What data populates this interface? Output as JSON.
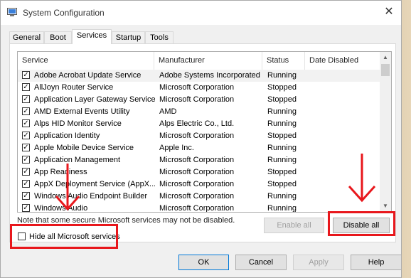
{
  "window": {
    "title": "System Configuration",
    "close_glyph": "✕"
  },
  "tabs": [
    {
      "label": "General"
    },
    {
      "label": "Boot"
    },
    {
      "label": "Services",
      "active": true
    },
    {
      "label": "Startup"
    },
    {
      "label": "Tools"
    }
  ],
  "table": {
    "columns": [
      "Service",
      "Manufacturer",
      "Status",
      "Date Disabled"
    ],
    "rows": [
      {
        "service": "Adobe Acrobat Update Service",
        "manufacturer": "Adobe Systems Incorporated",
        "status": "Running",
        "checked": true
      },
      {
        "service": "AllJoyn Router Service",
        "manufacturer": "Microsoft Corporation",
        "status": "Stopped",
        "checked": true
      },
      {
        "service": "Application Layer Gateway Service",
        "manufacturer": "Microsoft Corporation",
        "status": "Stopped",
        "checked": true
      },
      {
        "service": "AMD External Events Utility",
        "manufacturer": "AMD",
        "status": "Running",
        "checked": true
      },
      {
        "service": "Alps HID Monitor Service",
        "manufacturer": "Alps Electric Co., Ltd.",
        "status": "Running",
        "checked": true
      },
      {
        "service": "Application Identity",
        "manufacturer": "Microsoft Corporation",
        "status": "Stopped",
        "checked": true
      },
      {
        "service": "Apple Mobile Device Service",
        "manufacturer": "Apple Inc.",
        "status": "Running",
        "checked": true
      },
      {
        "service": "Application Management",
        "manufacturer": "Microsoft Corporation",
        "status": "Running",
        "checked": true
      },
      {
        "service": "App Readiness",
        "manufacturer": "Microsoft Corporation",
        "status": "Stopped",
        "checked": true
      },
      {
        "service": "AppX Deployment Service (AppX...",
        "manufacturer": "Microsoft Corporation",
        "status": "Stopped",
        "checked": true
      },
      {
        "service": "Windows Audio Endpoint Builder",
        "manufacturer": "Microsoft Corporation",
        "status": "Running",
        "checked": true
      },
      {
        "service": "Windows Audio",
        "manufacturer": "Microsoft Corporation",
        "status": "Running",
        "checked": true
      }
    ]
  },
  "note": "Note that some secure Microsoft services may not be disabled.",
  "buttons": {
    "enable_all": "Enable all",
    "disable_all": "Disable all",
    "ok": "OK",
    "cancel": "Cancel",
    "apply": "Apply",
    "help": "Help"
  },
  "hide_ms": {
    "label": "Hide all Microsoft services",
    "checked": false
  },
  "check_glyph": "✓",
  "scroll": {
    "up": "▲",
    "down": "▼"
  },
  "colors": {
    "highlight": "#e8171c",
    "accent": "#0078d7"
  }
}
